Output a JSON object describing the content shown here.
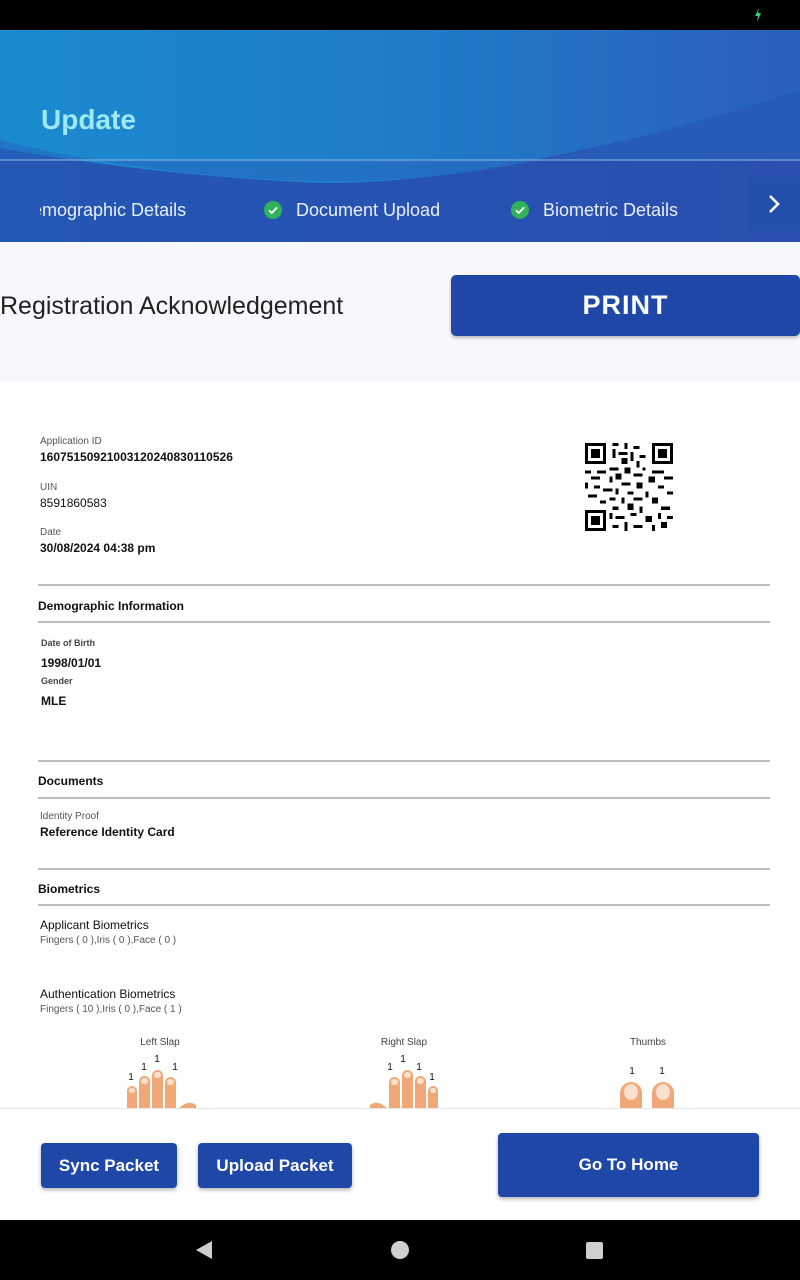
{
  "header": {
    "title": "Update",
    "steps": [
      {
        "label": "emographic Details",
        "completed": true
      },
      {
        "label": "Document Upload",
        "completed": true
      },
      {
        "label": "Biometric Details",
        "completed": true
      }
    ]
  },
  "acknowledgement": {
    "title": "Registration Acknowledgement",
    "print_label": "PRINT"
  },
  "receipt": {
    "application_id_label": "Application ID",
    "application_id": "16075150921003120240830110526",
    "uin_label": "UIN",
    "uin": "8591860583",
    "date_label": "Date",
    "date": "30/08/2024 04:38 pm",
    "demographic": {
      "heading": "Demographic Information",
      "dob_label": "Date of Birth",
      "dob": "1998/01/01",
      "gender_label": "Gender",
      "gender": "MLE"
    },
    "documents": {
      "heading": "Documents",
      "identity_proof_label": "Identity Proof",
      "identity_proof": "Reference Identity Card"
    },
    "biometrics": {
      "heading": "Biometrics",
      "applicant_title": "Applicant Biometrics",
      "applicant_counts": "Fingers ( 0 ),Iris ( 0 ),Face ( 0 )",
      "auth_title": "Authentication Biometrics",
      "auth_counts": "Fingers ( 10 ),Iris ( 0 ),Face ( 1 )",
      "slaps": [
        {
          "label": "Left Slap",
          "marks": [
            "1",
            "1",
            "1",
            "1"
          ]
        },
        {
          "label": "Right Slap",
          "marks": [
            "1",
            "1",
            "1",
            "1"
          ]
        },
        {
          "label": "Thumbs",
          "marks": [
            "1",
            "1"
          ]
        }
      ]
    }
  },
  "actions": {
    "sync_label": "Sync Packet",
    "upload_label": "Upload Packet",
    "home_label": "Go To Home"
  },
  "colors": {
    "primary": "#1e47a8",
    "header_light": "#5aa6e6",
    "title": "#9fe8f6",
    "check": "#2fb25a",
    "skin": "#f0a878"
  }
}
